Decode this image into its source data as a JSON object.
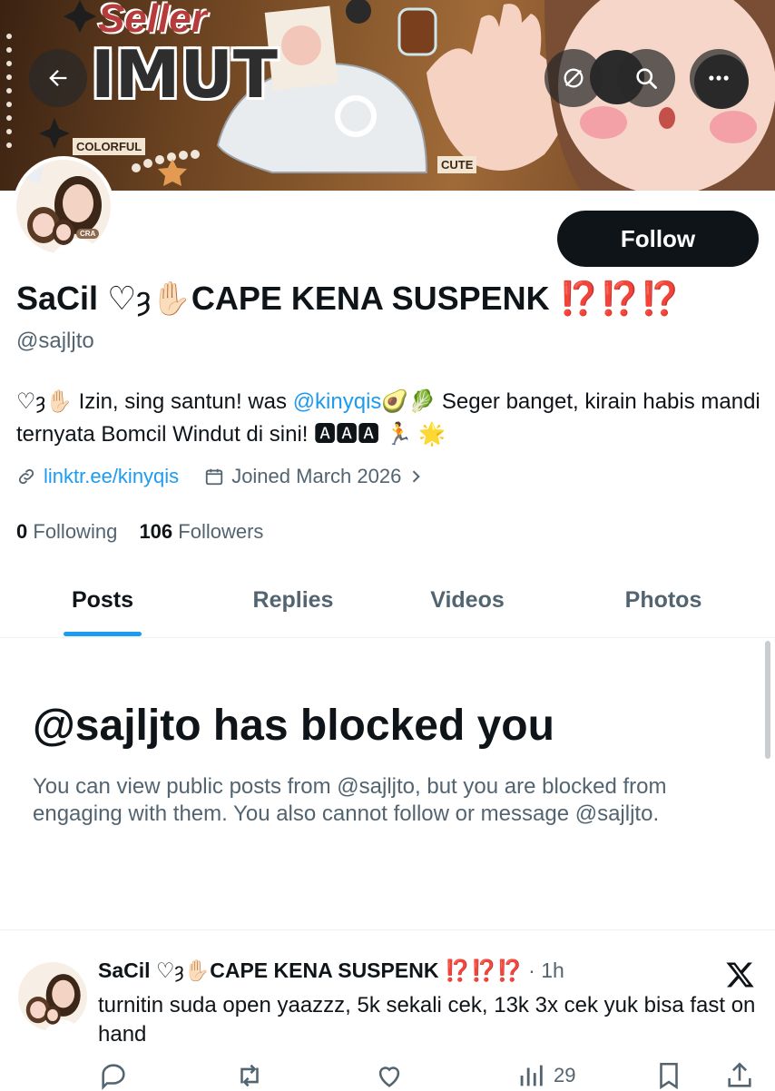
{
  "banner": {
    "title_line1": "Seller",
    "title_line2": "IMUT",
    "sticker_colorful": "COLORFUL",
    "sticker_cute": "CUTE"
  },
  "avatar_badge": "CRA",
  "header_buttons": [
    "back-arrow-icon",
    "hide-retweets-icon",
    "search-icon",
    "more-icon"
  ],
  "follow_label": "Follow",
  "profile": {
    "name_prefix": "SaCil",
    "name_rest": "CAPE KENA SUSPENK",
    "name_marks": "⁉️⁉️⁉️",
    "handle": "@sajljto",
    "bio_part1": "Izin, sing santun! was ",
    "bio_mention": "@kinyqis",
    "bio_part2": " Seger banget, kirain habis mandi ternyata Bomcil Windut di sini! ",
    "bio_emoji_tail": "🅰🅰🅰 🏃 🌟",
    "link": "linktr.ee/kinyqis",
    "joined": "Joined March 2026",
    "following_count": "0",
    "following_label": "Following",
    "followers_count": "106",
    "followers_label": "Followers"
  },
  "tabs": [
    "Posts",
    "Replies",
    "Videos",
    "Photos"
  ],
  "blocked": {
    "title": "@sajljto has blocked you",
    "description": "You can view public posts from @sajljto, but you are blocked from engaging with them. You also cannot follow or message @sajljto."
  },
  "post": {
    "name_prefix": "SaCil",
    "name_rest": "CAPE KENA SUSPENK",
    "name_marks": "⁉️⁉️⁉️",
    "time": "· 1h",
    "text": "turnitin suda open yaazzz, 5k sekali cek, 13k 3x cek yuk bisa fast on hand",
    "views": "29"
  },
  "colors": {
    "accent": "#1d9bf0",
    "text": "#0f1419",
    "muted": "#536471"
  }
}
